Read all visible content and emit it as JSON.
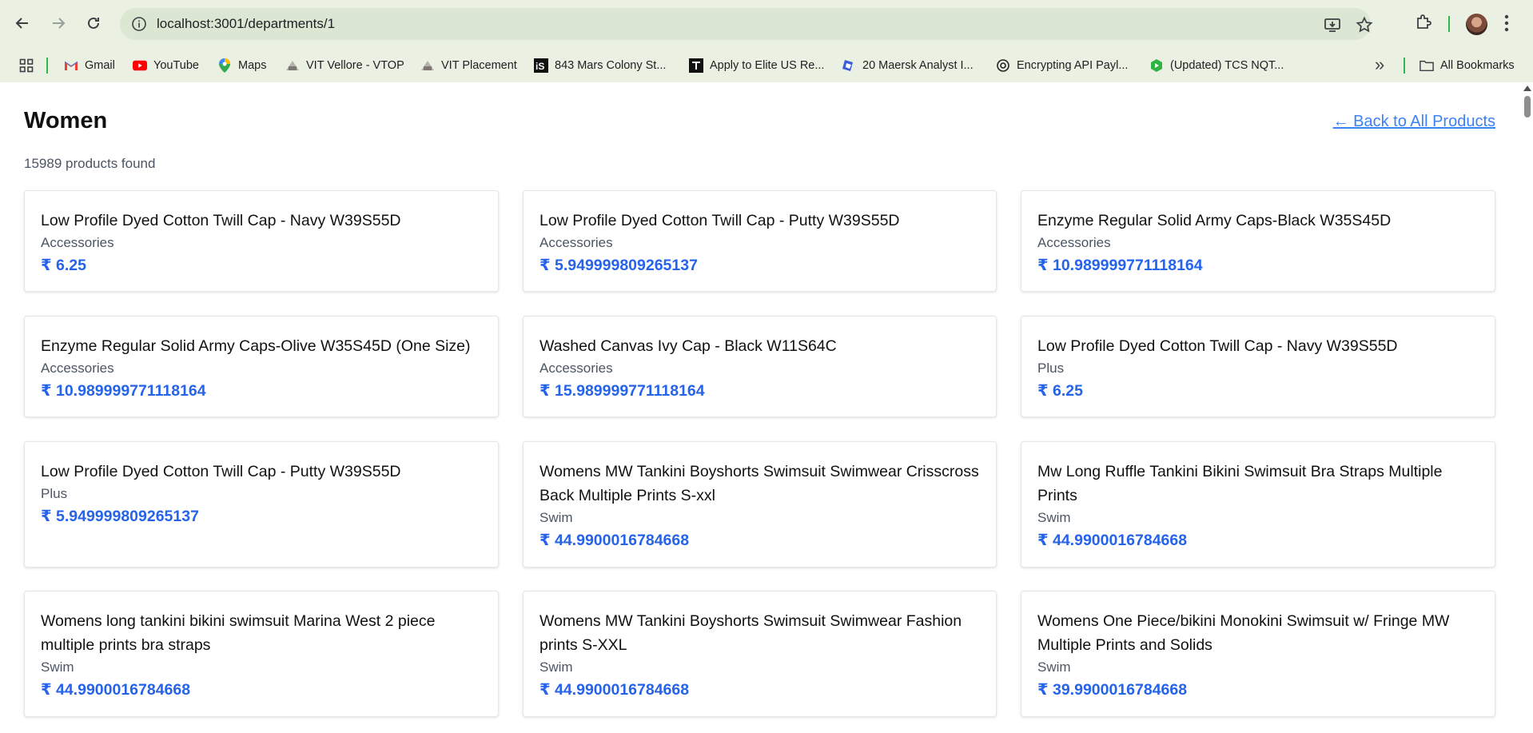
{
  "browser": {
    "url": "localhost:3001/departments/1",
    "bookmarks": [
      {
        "label": "Gmail",
        "icon": "gmail-icon"
      },
      {
        "label": "YouTube",
        "icon": "youtube-icon"
      },
      {
        "label": "Maps",
        "icon": "maps-icon"
      },
      {
        "label": "VIT Vellore - VTOP",
        "icon": "vit-icon"
      },
      {
        "label": "VIT Placement",
        "icon": "vit-icon"
      },
      {
        "label": "843 Mars Colony St...",
        "icon": "is-icon"
      },
      {
        "label": "Apply to Elite US Re...",
        "icon": "apply-icon"
      },
      {
        "label": "20 Maersk Analyst I...",
        "icon": "maersk-icon"
      },
      {
        "label": "Encrypting API Payl...",
        "icon": "openai-icon"
      },
      {
        "label": "(Updated) TCS NQT...",
        "icon": "tcs-icon"
      }
    ],
    "all_bookmarks": "All Bookmarks",
    "overflow": "»"
  },
  "page": {
    "title": "Women",
    "back_link": "← Back to All Products",
    "count": "15989 products found"
  },
  "products": [
    {
      "name": "Low Profile Dyed Cotton Twill Cap - Navy W39S55D",
      "category": "Accessories",
      "price": "₹ 6.25"
    },
    {
      "name": "Low Profile Dyed Cotton Twill Cap - Putty W39S55D",
      "category": "Accessories",
      "price": "₹ 5.949999809265137"
    },
    {
      "name": "Enzyme Regular Solid Army Caps-Black W35S45D",
      "category": "Accessories",
      "price": "₹ 10.989999771118164"
    },
    {
      "name": "Enzyme Regular Solid Army Caps-Olive W35S45D (One Size)",
      "category": "Accessories",
      "price": "₹ 10.989999771118164"
    },
    {
      "name": "Washed Canvas Ivy Cap - Black W11S64C",
      "category": "Accessories",
      "price": "₹ 15.989999771118164"
    },
    {
      "name": "Low Profile Dyed Cotton Twill Cap - Navy W39S55D",
      "category": "Plus",
      "price": "₹ 6.25"
    },
    {
      "name": "Low Profile Dyed Cotton Twill Cap - Putty W39S55D",
      "category": "Plus",
      "price": "₹ 5.949999809265137"
    },
    {
      "name": "Womens MW Tankini Boyshorts Swimsuit Swimwear Crisscross Back Multiple Prints S-xxl",
      "category": "Swim",
      "price": "₹ 44.9900016784668"
    },
    {
      "name": "Mw Long Ruffle Tankini Bikini Swimsuit Bra Straps Multiple Prints",
      "category": "Swim",
      "price": "₹ 44.9900016784668"
    },
    {
      "name": "Womens long tankini bikini swimsuit Marina West 2 piece multiple prints bra straps",
      "category": "Swim",
      "price": "₹ 44.9900016784668"
    },
    {
      "name": "Womens MW Tankini Boyshorts Swimsuit Swimwear Fashion prints S-XXL",
      "category": "Swim",
      "price": "₹ 44.9900016784668"
    },
    {
      "name": "Womens One Piece/bikini Monokini Swimsuit w/ Fringe MW Multiple Prints and Solids",
      "category": "Swim",
      "price": "₹ 39.9900016784668"
    }
  ]
}
